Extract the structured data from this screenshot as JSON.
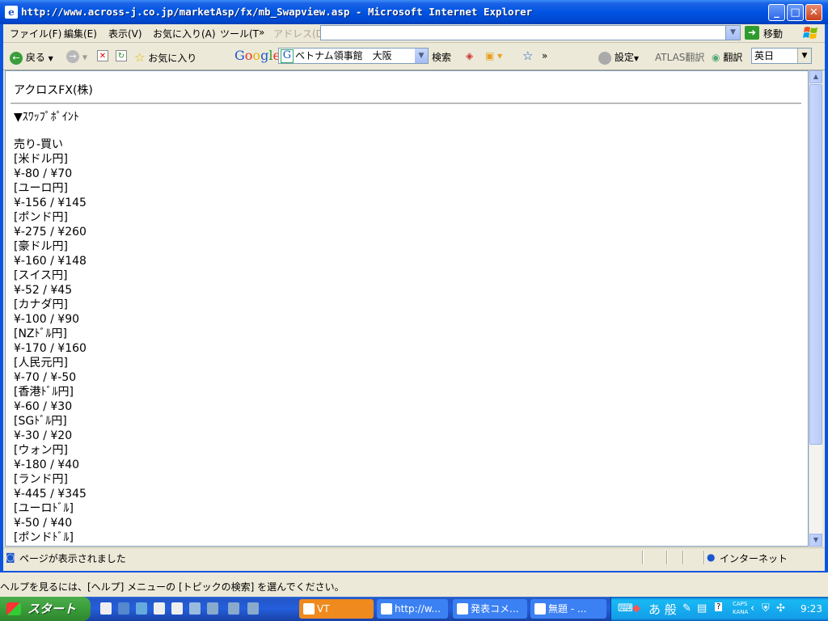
{
  "window": {
    "title": "http://www.across-j.co.jp/marketAsp/fx/mb_Swapview.asp - Microsoft Internet Explorer"
  },
  "menubar": {
    "items": [
      "ファイル(F)",
      "編集(E)",
      "表示(V)",
      "お気に入り(A)",
      "ツール(T"
    ],
    "more": "»",
    "address_label": "アドレス(D)",
    "address_value": "",
    "go_label": "移動"
  },
  "toolbar": {
    "back_label": "戻る",
    "favorites_label": "お気に入り",
    "google_label": "Google",
    "google_query": "ベトナム領事館　大阪",
    "search_label": "検索",
    "more": "»",
    "settings_label": "設定",
    "atlas_label": "ATLAS翻訳",
    "translate_label": "翻訳",
    "language_value": "英日"
  },
  "page": {
    "company": "アクロスFX(株)",
    "heading": "▼ｽﾜｯﾌﾟﾎﾟｲﾝﾄ",
    "sell_buy": "売り-買い",
    "swaps": [
      {
        "pair": "[米ドル円]",
        "value": "¥-80 / ¥70"
      },
      {
        "pair": "[ユーロ円]",
        "value": "¥-156 / ¥145"
      },
      {
        "pair": "[ポンド円]",
        "value": "¥-275 / ¥260"
      },
      {
        "pair": "[豪ドル円]",
        "value": "¥-160 / ¥148"
      },
      {
        "pair": "[スイス円]",
        "value": "¥-52 / ¥45"
      },
      {
        "pair": "[カナダ円]",
        "value": "¥-100 / ¥90"
      },
      {
        "pair": "[NZﾄﾞﾙ円]",
        "value": "¥-170 / ¥160"
      },
      {
        "pair": "[人民元円]",
        "value": "¥-70 / ¥-50"
      },
      {
        "pair": "[香港ﾄﾞﾙ円]",
        "value": "¥-60 / ¥30"
      },
      {
        "pair": "[SGﾄﾞﾙ円]",
        "value": "¥-30 / ¥20"
      },
      {
        "pair": "[ウォン円]",
        "value": "¥-180 / ¥40"
      },
      {
        "pair": "[ランド円]",
        "value": "¥-445 / ¥345"
      },
      {
        "pair": "[ユーロﾄﾞﾙ]",
        "value": "¥-50 / ¥40"
      },
      {
        "pair": "[ポンドﾄﾞﾙ]",
        "value": ""
      }
    ]
  },
  "statusbar": {
    "text": "ページが表示されました",
    "zone": "インターネット"
  },
  "helpline": "ヘルプを見るには、[ヘルプ] メニューの [トピックの検索] を選んでください。",
  "taskbar": {
    "start_label": "スタート",
    "tasks": [
      "VT",
      "http://w...",
      "発表コメ...",
      "無題 - ..."
    ],
    "ime_text": "あ 般",
    "clock": "9:23",
    "caps": "CAPS",
    "kana": "KANA"
  },
  "colors": {
    "titlebar": "#0054e3",
    "start": "#3a9d3a",
    "active_task": "#ef8a1e"
  }
}
